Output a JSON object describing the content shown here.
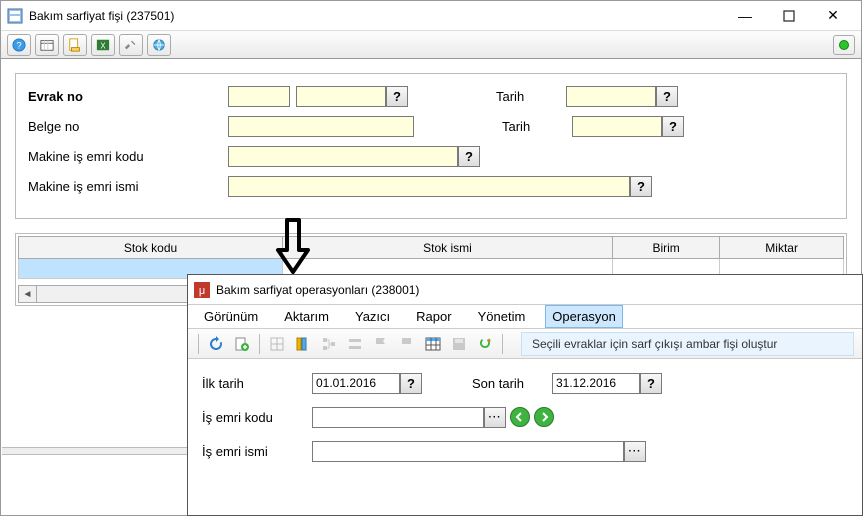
{
  "window1": {
    "title": "Bakım sarfiyat fişi (237501)",
    "form": {
      "evrak_no_label": "Evrak no",
      "belge_no_label": "Belge no",
      "makine_is_emri_kodu_label": "Makine iş emri kodu",
      "makine_is_emri_ismi_label": "Makine iş emri ismi",
      "tarih_label": "Tarih",
      "evrak_no_1": "",
      "evrak_no_2": "",
      "belge_no": "",
      "tarih_1": "",
      "tarih_2": "",
      "makine_kodu": "",
      "makine_ismi": ""
    },
    "grid": {
      "col_stok_kodu": "Stok kodu",
      "col_stok_ismi": "Stok ismi",
      "col_birim": "Birim",
      "col_miktar": "Miktar"
    }
  },
  "window2": {
    "title": "Bakım sarfiyat operasyonları (238001)",
    "menu": {
      "gorunum": "Görünüm",
      "aktarim": "Aktarım",
      "yazici": "Yazıcı",
      "rapor": "Rapor",
      "yonetim": "Yönetim",
      "operasyon": "Operasyon"
    },
    "hint": "Seçili evraklar için sarf çıkışı ambar fişi oluştur",
    "form": {
      "ilk_tarih_label": "İlk tarih",
      "ilk_tarih": "01.01.2016",
      "son_tarih_label": "Son tarih",
      "son_tarih": "31.12.2016",
      "is_emri_kodu_label": "İş emri kodu",
      "is_emri_kodu": "",
      "is_emri_ismi_label": "İş emri ismi",
      "is_emri_ismi": ""
    }
  },
  "glyph": {
    "question": "?",
    "ellipsis": "···",
    "minimize": "—",
    "close": "✕"
  }
}
